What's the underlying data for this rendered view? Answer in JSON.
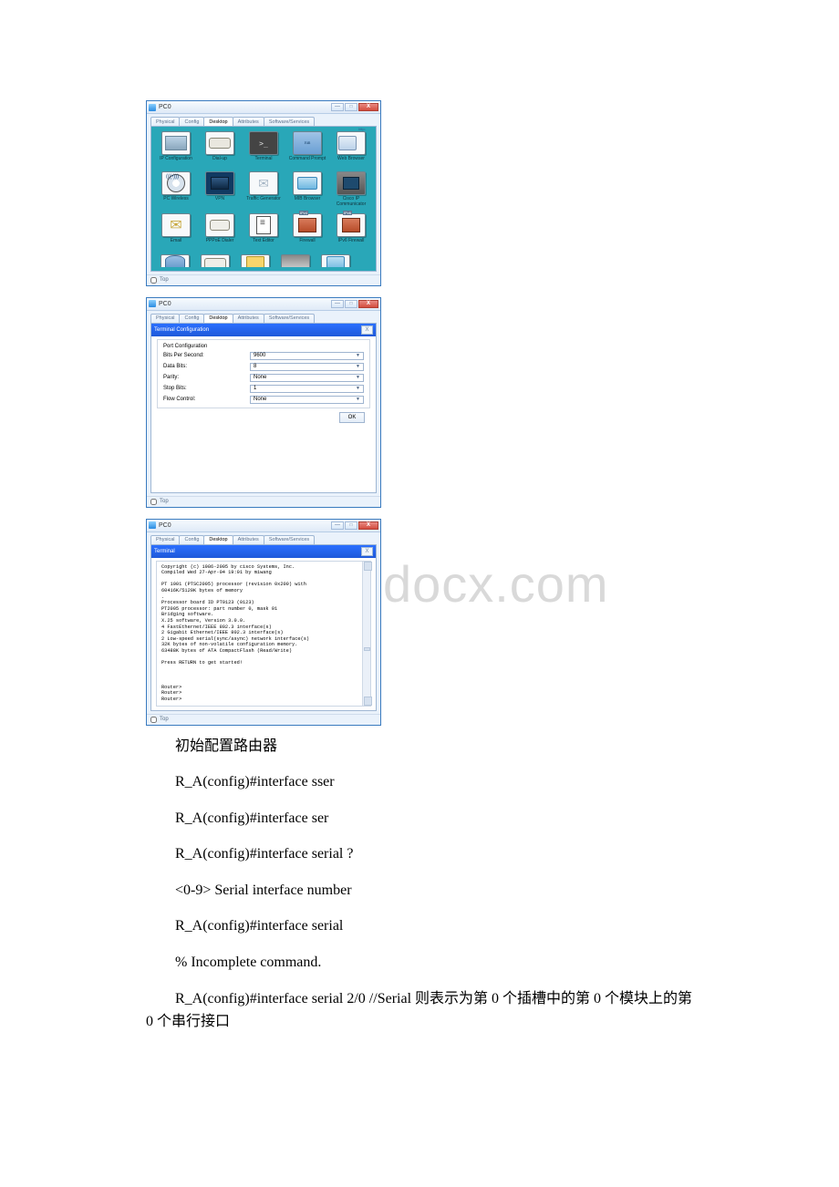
{
  "watermark": "www.bdocx.com",
  "win1": {
    "title": "PC0",
    "status": "",
    "tabs": [
      "Physical",
      "Config",
      "Desktop",
      "Attributes",
      "Software/Services"
    ],
    "active": "Desktop",
    "apps_row1": [
      {
        "label": "IP\nConfiguration",
        "cls": "ico-ip"
      },
      {
        "label": "Dial-up",
        "cls": "ico-dial"
      },
      {
        "label": "Terminal",
        "cls": "ico-term"
      },
      {
        "label": "Command\nPrompt",
        "cls": "ico-cmd"
      },
      {
        "label": "Web Browser",
        "cls": "ico-web"
      }
    ],
    "apps_row2": [
      {
        "label": "PC Wireless",
        "cls": "ico-wifi"
      },
      {
        "label": "VPN",
        "cls": "ico-vpn"
      },
      {
        "label": "Traffic Generator",
        "cls": "ico-traf"
      },
      {
        "label": "MIB Browser",
        "cls": "ico-mib"
      },
      {
        "label": "Cisco IP\nCommunicator",
        "cls": "ico-ipcom"
      }
    ],
    "apps_row3": [
      {
        "label": "Email",
        "cls": "ico-email"
      },
      {
        "label": "PPPoE Dialer",
        "cls": "ico-pppoe"
      },
      {
        "label": "Text Editor",
        "cls": "ico-text"
      },
      {
        "label": "Firewall",
        "cls": "ico-fw"
      },
      {
        "label": "IPv6 Firewall",
        "cls": "ico-fw6"
      }
    ],
    "top": "Top"
  },
  "win2": {
    "title": "PC0",
    "tabs": [
      "Physical",
      "Config",
      "Desktop",
      "Attributes",
      "Software/Services"
    ],
    "active": "Desktop",
    "panel_title": "Terminal Configuration",
    "section": "Port Configuration",
    "fields": [
      {
        "label": "Bits Per Second:",
        "value": "9600"
      },
      {
        "label": "Data Bits:",
        "value": "8"
      },
      {
        "label": "Parity:",
        "value": "None"
      },
      {
        "label": "Stop Bits:",
        "value": "1"
      },
      {
        "label": "Flow Control:",
        "value": "None"
      }
    ],
    "ok": "OK",
    "top": "Top"
  },
  "win3": {
    "title": "PC0",
    "tabs": [
      "Physical",
      "Config",
      "Desktop",
      "Attributes",
      "Software/Services"
    ],
    "active": "Desktop",
    "panel_title": "Terminal",
    "output": "Copyright (c) 1986-2005 by cisco Systems, Inc.\nCompiled Wed 27-Apr-04 19:01 by miwang\n\nPT 1001 (PTSC2005) processor (revision 0x200) with\n60416K/5120K bytes of memory\n.\nProcessor board ID PT0123 (0123)\nPT2005 processor: part number 0, mask 01\nBridging software.\nX.25 software, Version 3.0.0.\n4 FastEthernet/IEEE 802.3 interface(s)\n2 Gigabit Ethernet/IEEE 802.3 interface(s)\n2 Low-speed serial(sync/async) network interface(s)\n32K bytes of non-volatile configuration memory.\n63488K bytes of ATA CompactFlash (Read/Write)\n\nPress RETURN to get started!\n\n\n\nRouter>\nRouter>\nRouter>",
    "top": "Top"
  },
  "body": {
    "p1": "初始配置路由器",
    "p2": "R_A(config)#interface sser",
    "p3": "R_A(config)#interface ser",
    "p4": "R_A(config)#interface serial ?",
    "p5": "<0-9> Serial interface number",
    "p6": "R_A(config)#interface serial",
    "p7": "% Incomplete command.",
    "p8a": "R_A(config)#interface serial 2/0 //Serial 则表示为第 0 个插槽中的第 0 个模块上的第",
    "p8b": "0 个串行接口"
  }
}
